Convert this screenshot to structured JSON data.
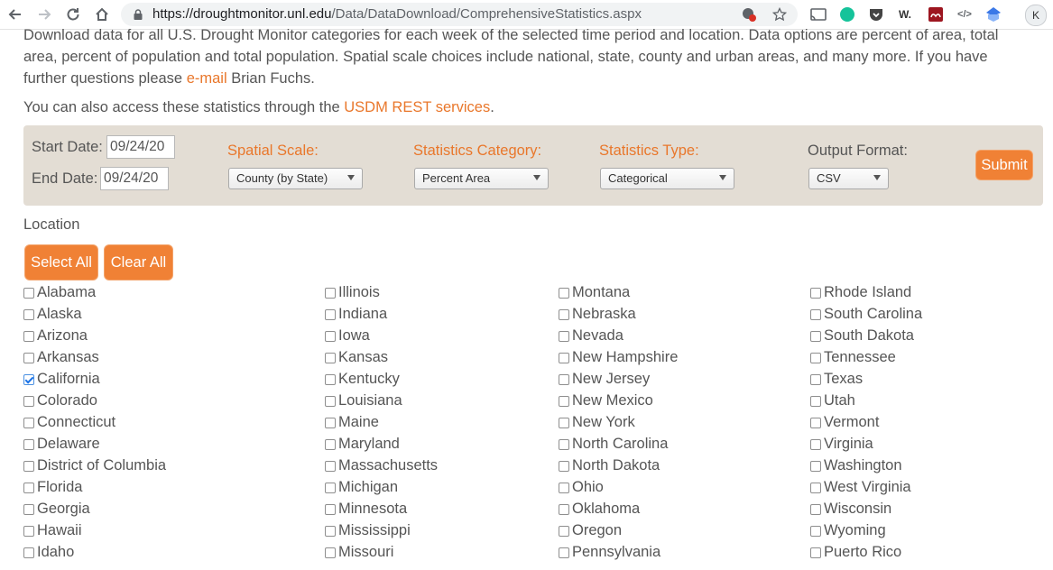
{
  "browser": {
    "url_host": "https://droughtmonitor.unl.edu",
    "url_path": "/Data/DataDownload/ComprehensiveStatistics.aspx",
    "profile_initial": "K"
  },
  "intro": {
    "line1": "Download data for all U.S. Drought Monitor categories for each week of the selected time period and location. Data options are percent of area, total",
    "line2": "area, percent of population and total population. Spatial scale choices include national, state, county and urban areas, and many more. If you have",
    "line3_prefix": "further questions please ",
    "email_link": "e-mail",
    "line3_suffix": " Brian Fuchs.",
    "rest_prefix": "You can also access these statistics through the ",
    "rest_link": "USDM REST services",
    "rest_suffix": "."
  },
  "form": {
    "start_label": "Start Date:",
    "start_value": "09/24/20",
    "end_label": "End Date:",
    "end_value": "09/24/20",
    "spatial_label": "Spatial Scale:",
    "spatial_value": "County (by State)",
    "category_label": "Statistics Category:",
    "category_value": "Percent Area",
    "type_label": "Statistics Type:",
    "type_value": "Categorical",
    "output_label": "Output Format:",
    "output_value": "CSV",
    "submit_label": "Submit"
  },
  "location": {
    "title": "Location",
    "select_all": "Select All",
    "clear_all": "Clear All",
    "columns": [
      [
        "Alabama",
        "Alaska",
        "Arizona",
        "Arkansas",
        "California",
        "Colorado",
        "Connecticut",
        "Delaware",
        "District of Columbia",
        "Florida",
        "Georgia",
        "Hawaii",
        "Idaho"
      ],
      [
        "Illinois",
        "Indiana",
        "Iowa",
        "Kansas",
        "Kentucky",
        "Louisiana",
        "Maine",
        "Maryland",
        "Massachusetts",
        "Michigan",
        "Minnesota",
        "Mississippi",
        "Missouri"
      ],
      [
        "Montana",
        "Nebraska",
        "Nevada",
        "New Hampshire",
        "New Jersey",
        "New Mexico",
        "New York",
        "North Carolina",
        "North Dakota",
        "Ohio",
        "Oklahoma",
        "Oregon",
        "Pennsylvania"
      ],
      [
        "Rhode Island",
        "South Carolina",
        "South Dakota",
        "Tennessee",
        "Texas",
        "Utah",
        "Vermont",
        "Virginia",
        "Washington",
        "West Virginia",
        "Wisconsin",
        "Wyoming",
        "Puerto Rico"
      ]
    ],
    "checked": [
      "California"
    ]
  },
  "colors": {
    "accent": "#f08135",
    "link": "#e9772b",
    "form_bg": "#e3ddd4"
  }
}
